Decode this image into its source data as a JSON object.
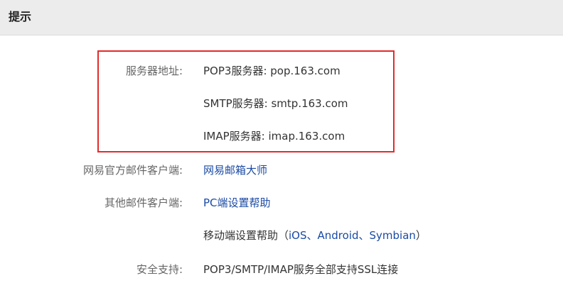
{
  "header": {
    "title": "提示"
  },
  "server": {
    "label": "服务器地址:",
    "pop3": "POP3服务器: pop.163.com",
    "smtp": "SMTP服务器: smtp.163.com",
    "imap": "IMAP服务器: imap.163.com"
  },
  "official_client": {
    "label": "网易官方邮件客户端:",
    "link": "网易邮箱大师"
  },
  "other_clients": {
    "label": "其他邮件客户端:",
    "pc_link": "PC端设置帮助",
    "mobile_prefix": "移动端设置帮助（",
    "mobile_link": "iOS、Android、Symbian",
    "mobile_suffix": "）"
  },
  "security": {
    "label": "安全支持:",
    "value": "POP3/SMTP/IMAP服务全部支持SSL连接"
  },
  "colors": {
    "link": "#1a4aa5",
    "highlight_border": "#e32b2b",
    "header_bg": "#ececec"
  }
}
